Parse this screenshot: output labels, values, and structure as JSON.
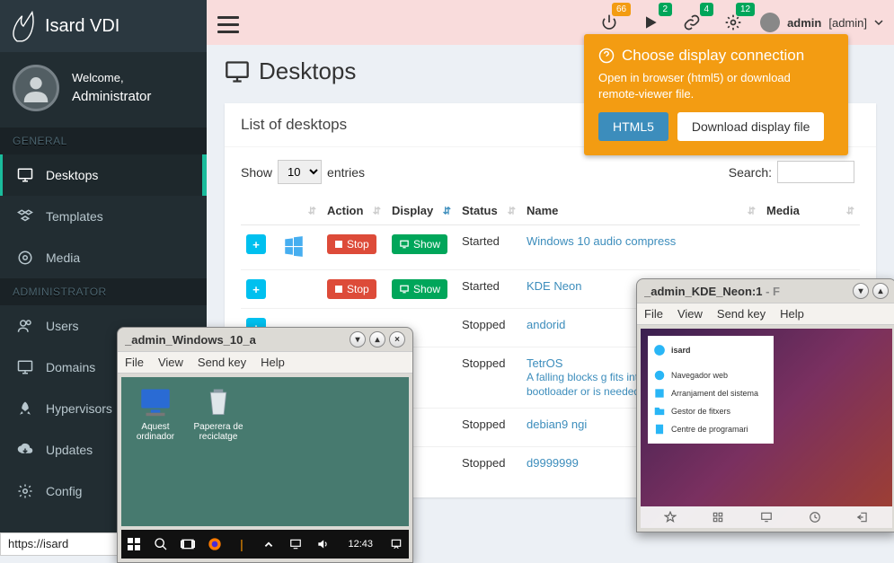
{
  "brand": "Isard VDI",
  "user_panel": {
    "welcome": "Welcome,",
    "name": "Administrator"
  },
  "sections": {
    "general": "GENERAL",
    "admin": "ADMINISTRATOR"
  },
  "menu": {
    "desktops": "Desktops",
    "templates": "Templates",
    "media": "Media",
    "users": "Users",
    "domains": "Domains",
    "hypervisors": "Hypervisors",
    "updates": "Updates",
    "config": "Config"
  },
  "topbar": {
    "badges": [
      "66",
      "2",
      "4",
      "12"
    ],
    "user": "admin",
    "role": "[admin]"
  },
  "popover": {
    "title": "Choose display connection",
    "body": "Open in browser (html5) or download remote-viewer file.",
    "btn_html5": "HTML5",
    "btn_download": "Download display file"
  },
  "page": {
    "title": "Desktops"
  },
  "panel": {
    "title": "List of desktops",
    "show_prefix": "Show",
    "show_value": "10",
    "show_suffix": "entries",
    "search_label": "Search:",
    "cols": {
      "action": "Action",
      "display": "Display",
      "status": "Status",
      "name": "Name",
      "media": "Media"
    },
    "btn_stop": "Stop",
    "btn_show": "Show",
    "rows": [
      {
        "status": "Started",
        "name": "Windows 10 audio compress",
        "desc": "",
        "stoppable": true
      },
      {
        "status": "Started",
        "name": "KDE Neon",
        "desc": "",
        "stoppable": true
      },
      {
        "status": "Stopped",
        "name": "andorid",
        "desc": "",
        "stoppable": false
      },
      {
        "status": "Stopped",
        "name": "TetrOS",
        "desc": "A falling blocks g fits into the Mast No bootloader or is needed to rota clear rows!",
        "stoppable": false
      },
      {
        "status": "Stopped",
        "name": "debian9 ngi",
        "desc": "",
        "stoppable": false
      },
      {
        "status": "Stopped",
        "name": "d9999999",
        "desc": "",
        "stoppable": false
      }
    ]
  },
  "viewer_windows": {
    "win1": {
      "title": "_admin_Windows_10_a",
      "menus": [
        "File",
        "View",
        "Send key",
        "Help"
      ],
      "icons": {
        "pc": "Aquest ordinador",
        "bin": "Paperera de reciclatge"
      },
      "clock": "12:43"
    },
    "win2": {
      "title_a": "_admin_KDE_Neon:1",
      "title_b": " - F",
      "menus": [
        "File",
        "View",
        "Send key",
        "Help"
      ],
      "panel_head": "isard",
      "panel_items": [
        "Navegador web",
        "Arranjament del sistema",
        "Gestor de fitxers",
        "Centre de programari"
      ]
    }
  },
  "statusbar": "https://isard"
}
